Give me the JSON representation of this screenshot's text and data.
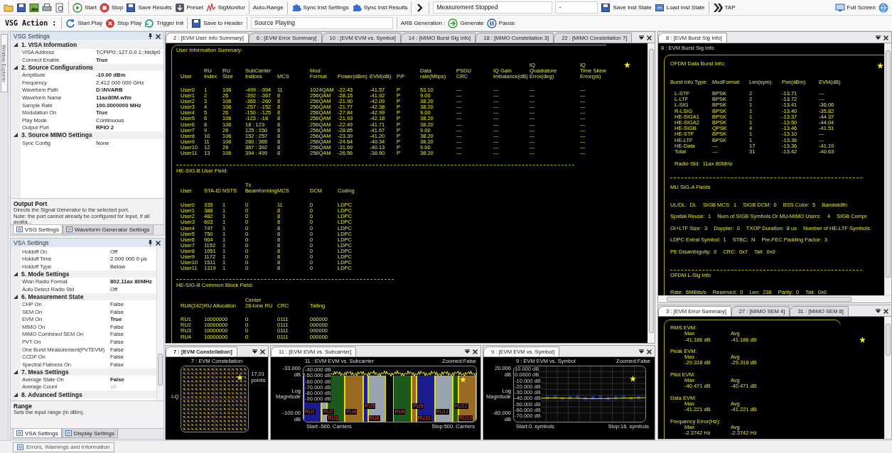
{
  "toolbar": {
    "row1": {
      "left": [
        {
          "kind": "icon"
        },
        {
          "kind": "icon"
        },
        {
          "kind": "icon"
        },
        {
          "kind": "icon"
        },
        {
          "kind": "icon"
        },
        {
          "kind": "sep"
        },
        {
          "kind": "button",
          "label": "Start"
        },
        {
          "kind": "button",
          "label": "Stop"
        },
        {
          "kind": "button",
          "label": "Save Results"
        },
        {
          "kind": "button",
          "label": "Preset"
        },
        {
          "kind": "button",
          "label": "SigMonitor"
        },
        {
          "kind": "sep"
        },
        {
          "kind": "text",
          "label": "Auto-Range"
        },
        {
          "kind": "sep"
        },
        {
          "kind": "button",
          "label": "Sync Inst Settings"
        },
        {
          "kind": "button",
          "label": "Sync Inst Results"
        },
        {
          "kind": "sep"
        },
        {
          "kind": "icon"
        },
        {
          "kind": "sep"
        },
        {
          "kind": "status",
          "label": "Measurement Stopped"
        },
        {
          "kind": "status",
          "label": "-"
        },
        {
          "kind": "button",
          "label": "Save Inst State"
        },
        {
          "kind": "button",
          "label": "Load Inst State"
        },
        {
          "kind": "sep"
        },
        {
          "kind": "button",
          "label": "TAP"
        }
      ],
      "right": [
        {
          "kind": "button",
          "label": "Full Screen"
        },
        {
          "kind": "icon"
        }
      ]
    },
    "row2": [
      {
        "kind": "title",
        "label": "VSG Action :"
      },
      {
        "kind": "sep"
      },
      {
        "kind": "button",
        "label": "Start Play"
      },
      {
        "kind": "button",
        "label": "Stop Play"
      },
      {
        "kind": "button",
        "label": "Trigger Init"
      },
      {
        "kind": "sep"
      },
      {
        "kind": "button",
        "label": "Save to Header"
      },
      {
        "kind": "sep"
      },
      {
        "kind": "status",
        "label": "Source Playing"
      },
      {
        "kind": "sep"
      },
      {
        "kind": "text",
        "label": "ARB Generation :"
      },
      {
        "kind": "button",
        "label": "Generate"
      },
      {
        "kind": "button",
        "label": "Pause"
      }
    ]
  },
  "side_tab": "Window Explorer",
  "vsg_panel": {
    "title": "VSG Settings",
    "grid": [
      {
        "kind": "category",
        "name": "1. VISA Information",
        "expanded": true
      },
      {
        "kind": "property",
        "name": "VISA Address",
        "value": "TCPIP0::127.0.0.1::hislip0",
        "bold": false
      },
      {
        "kind": "property",
        "name": "Connect Enable",
        "value": "True",
        "bold": true
      },
      {
        "kind": "category",
        "name": "2. Source Configurations",
        "expanded": true
      },
      {
        "kind": "property",
        "name": "Amplitude",
        "value": "-10.00 dBm",
        "bold": true
      },
      {
        "kind": "property",
        "name": "Frequency",
        "value": "2.412 000 000 GHz",
        "bold": false
      },
      {
        "kind": "property",
        "name": "Waveform Path",
        "value": "D:\\NVARB",
        "bold": true
      },
      {
        "kind": "property",
        "name": "Waveform Name",
        "value": "11ax80M.wfm",
        "bold": true
      },
      {
        "kind": "property",
        "name": "Sample Rate",
        "value": "100.0000000 MHz",
        "bold": true
      },
      {
        "kind": "property",
        "name": "Modulation On",
        "value": "True",
        "bold": true
      },
      {
        "kind": "property",
        "name": "Play Mode",
        "value": "Continuous",
        "bold": false
      },
      {
        "kind": "property",
        "name": "Output Port",
        "value": "RFIO 2",
        "bold": true
      },
      {
        "kind": "category",
        "name": "3. Source MIMO Settings",
        "expanded": true
      },
      {
        "kind": "property",
        "name": "Sync Config",
        "value": "None",
        "bold": false
      }
    ],
    "description": {
      "title": "Output Port",
      "lines": [
        "Directs the Signal Generator to the selected port.",
        "Note: the port cannot already be configured for Input, if all availa..."
      ]
    },
    "tabs": [
      {
        "label": "VSG Settings",
        "selected": true
      },
      {
        "label": "Waveform Generator Settings",
        "selected": false
      }
    ]
  },
  "vsa_panel": {
    "title": "VSA Settings",
    "grid": [
      {
        "kind": "property",
        "name": "Holdoff On",
        "value": "Off",
        "bold": false,
        "disabled": false
      },
      {
        "kind": "property",
        "name": "Holdoff Time",
        "value": "2.000 000 0 µs",
        "bold": false,
        "disabled": false
      },
      {
        "kind": "property",
        "name": "Holdoff Type",
        "value": "Below",
        "bold": false,
        "disabled": false
      },
      {
        "kind": "category",
        "name": "5. Mode Settings",
        "expanded": true
      },
      {
        "kind": "property",
        "name": "Wlan Radio Format",
        "value": "802.11ax 80MHz",
        "bold": true,
        "disabled": false
      },
      {
        "kind": "property",
        "name": "Auto Detect Radio Std",
        "value": "Off",
        "bold": false,
        "disabled": false
      },
      {
        "kind": "category",
        "name": "6. Measurement State",
        "expanded": true
      },
      {
        "kind": "property",
        "name": "CHP On",
        "value": "False",
        "bold": false,
        "disabled": false
      },
      {
        "kind": "property",
        "name": "SEM On",
        "value": "False",
        "bold": false,
        "disabled": false
      },
      {
        "kind": "property",
        "name": "EVM On",
        "value": "True",
        "bold": true,
        "disabled": false
      },
      {
        "kind": "property",
        "name": "MIMO On",
        "value": "False",
        "bold": false,
        "disabled": false
      },
      {
        "kind": "property",
        "name": "MIMO Combined SEM On",
        "value": "False",
        "bold": false,
        "disabled": false
      },
      {
        "kind": "property",
        "name": "PVT On",
        "value": "False",
        "bold": false,
        "disabled": false
      },
      {
        "kind": "property",
        "name": "One Burst Measurement(PVTEVM)",
        "value": "False",
        "bold": false,
        "disabled": false
      },
      {
        "kind": "property",
        "name": "CCDF On",
        "value": "False",
        "bold": false,
        "disabled": false
      },
      {
        "kind": "property",
        "name": "Spectral Flatness On",
        "value": "False",
        "bold": false,
        "disabled": false
      },
      {
        "kind": "category",
        "name": "7. Meas Settings",
        "expanded": true
      },
      {
        "kind": "property",
        "name": "Average State On",
        "value": "False",
        "bold": true,
        "disabled": false
      },
      {
        "kind": "property",
        "name": "Average Count",
        "value": "10",
        "bold": false,
        "disabled": true
      },
      {
        "kind": "category",
        "name": "8. Advanced Settings",
        "expanded": true
      }
    ],
    "description": {
      "title": "Range",
      "lines": [
        "Sets the input range (in dBm)."
      ]
    },
    "tabs": [
      {
        "label": "VSA Settings",
        "selected": true
      },
      {
        "label": "Display Settings",
        "selected": false
      }
    ]
  },
  "status_tab": "Errors, Warnings and Information",
  "user_info": {
    "tabs": [
      {
        "label": "2 : [EVM User Info Summary]",
        "selected": true
      },
      {
        "label": "6 : [EVM Error Summary]",
        "selected": false
      },
      {
        "label": "10 : [EVM EVM vs. Symbol]",
        "selected": false
      },
      {
        "label": "14 : [MIMO Burst Sig Info]",
        "selected": false
      },
      {
        "label": "18 : [MIMO Constellation 3]",
        "selected": false
      },
      {
        "label": "22 : [MIMO Constellation 7]",
        "selected": false
      }
    ],
    "summary_title": "User Information Summary:",
    "summary_columns": [
      "User",
      "RU\nIndex",
      "RU\nSize",
      "SubCarrier\nIndices",
      "MCS",
      "Mod\nFormat",
      "Power(dBm)",
      "EVM(dB)",
      "P/F",
      "Data\nrate(Mbps)",
      "PSDU\nCRC",
      "IQ Gain\nImbalance(dB)",
      "IQ\nQuadrature\nError(deg)",
      "IQ\nTime Skew\nError(ps)"
    ],
    "summary_rows": [
      [
        "User0",
        "1",
        "106",
        "-499 : -394",
        "11",
        "1024QAM",
        "-22.43",
        "-41.57",
        "P",
        "53.10",
        "---",
        "---",
        "---",
        "---"
      ],
      [
        "User1",
        "2",
        "26",
        "-392 : -367",
        "8",
        "256QAM",
        "-28.15",
        "-41.92",
        "P",
        "9.00",
        "---",
        "---",
        "---",
        "---"
      ],
      [
        "User2",
        "3",
        "106",
        "-365 : -260",
        "8",
        "256QAM",
        "-21.90",
        "-42.09",
        "P",
        "38.20",
        "---",
        "---",
        "---",
        "---"
      ],
      [
        "User3",
        "4",
        "106",
        "-257 : -152",
        "8",
        "256QAM",
        "-21.77",
        "-42.38",
        "P",
        "38.20",
        "---",
        "---",
        "---",
        "---"
      ],
      [
        "User4",
        "5",
        "26",
        "-150 : -125",
        "8",
        "256QAM",
        "-27.84",
        "-42.99",
        "P",
        "9.00",
        "---",
        "---",
        "---",
        "---"
      ],
      [
        "User5",
        "6",
        "106",
        "-123 : -18",
        "8",
        "256QAM",
        "-21.93",
        "-42.18",
        "P",
        "38.20",
        "---",
        "---",
        "---",
        "---"
      ],
      [
        "User6",
        "8",
        "106",
        "18 : 123",
        "8",
        "256QAM",
        "-22.49",
        "-41.71",
        "P",
        "38.20",
        "---",
        "---",
        "---",
        "---"
      ],
      [
        "User7",
        "9",
        "26",
        "125 : 150",
        "8",
        "256QAM",
        "-28.85",
        "-41.67",
        "P",
        "9.00",
        "---",
        "---",
        "---",
        "---"
      ],
      [
        "User8",
        "10",
        "106",
        "152 : 257",
        "8",
        "256QAM",
        "-23.39",
        "-41.20",
        "P",
        "38.20",
        "---",
        "---",
        "---",
        "---"
      ],
      [
        "User9",
        "11",
        "106",
        "260 : 365",
        "8",
        "256QAM",
        "-24.64",
        "-40.34",
        "P",
        "38.20",
        "---",
        "---",
        "---",
        "---"
      ],
      [
        "User10",
        "12",
        "26",
        "367 : 392",
        "8",
        "256QAM",
        "-31.69",
        "-40.13",
        "P",
        "9.00",
        "---",
        "---",
        "---",
        "---"
      ],
      [
        "User11",
        "13",
        "106",
        "394 : 499",
        "8",
        "256QAM",
        "-26.56",
        "-38.90",
        "P",
        "38.20",
        "---",
        "---",
        "---",
        "---"
      ]
    ],
    "user_field_title": "HE-SIG-B User Field:",
    "user_field_columns": [
      "User",
      "STA-ID",
      "NSTS",
      "Tx\nBeamforming",
      "MCS",
      "DCM",
      "Coding"
    ],
    "user_field_rows": [
      [
        "User0",
        "335",
        "1",
        "0",
        "11",
        "0",
        "LDPC"
      ],
      [
        "User1",
        "388",
        "1",
        "0",
        "8",
        "0",
        "LDPC"
      ],
      [
        "User2",
        "482",
        "1",
        "0",
        "8",
        "0",
        "LDPC"
      ],
      [
        "User3",
        "603",
        "1",
        "0",
        "8",
        "0",
        "LDPC"
      ],
      [
        "User4",
        "747",
        "1",
        "0",
        "8",
        "0",
        "LDPC"
      ],
      [
        "User5",
        "750",
        "1",
        "0",
        "8",
        "0",
        "LDPC"
      ],
      [
        "User6",
        "904",
        "1",
        "0",
        "8",
        "0",
        "LDPC"
      ],
      [
        "User7",
        "1152",
        "1",
        "0",
        "8",
        "0",
        "LDPC"
      ],
      [
        "User8",
        "1051",
        "1",
        "0",
        "8",
        "0",
        "LDPC"
      ],
      [
        "User9",
        "1172",
        "1",
        "0",
        "8",
        "0",
        "LDPC"
      ],
      [
        "User10",
        "1511",
        "1",
        "0",
        "8",
        "0",
        "LDPC"
      ],
      [
        "User11",
        "1319",
        "1",
        "0",
        "8",
        "0",
        "LDPC"
      ]
    ],
    "common_title": "HE-SIG-B Common Block Field:",
    "common_columns": [
      "RU#(242)",
      "RU Allocation",
      "Center\n26-tone RU",
      "CRC",
      "Tailing"
    ],
    "common_rows": [
      [
        "RU1",
        "10000000",
        "0",
        "0111",
        "000000"
      ],
      [
        "RU2",
        "10000000",
        "0",
        "0111",
        "000000"
      ],
      [
        "RU3",
        "10000000",
        "0",
        "0111",
        "000000"
      ],
      [
        "RU4",
        "10000000",
        "0",
        "0111",
        "000000"
      ]
    ]
  },
  "burst_panel": {
    "tabs": [
      {
        "label": "8 : [EVM Burst Sig Info]",
        "selected": true
      }
    ],
    "title": "8 : EVM Burst Sig Info",
    "data_title": "OFDM Data Burst Info:",
    "columns": [
      "Burst Info Type:",
      "ModFormat",
      "Len(sym)",
      "Pwr(dBm)",
      "EVM(dB)"
    ],
    "rows": [
      [
        "L-STF",
        "BPSK",
        "2",
        "-13.71",
        "---"
      ],
      [
        "L-LTF",
        "BPSK",
        "2",
        "-13.72",
        "---"
      ],
      [
        "L-SIG",
        "BPSK",
        "1",
        "-13.41",
        "-36.06"
      ],
      [
        "R-LSIG",
        "BPSK",
        "1",
        "-13.40",
        "-35.82"
      ],
      [
        "HE-SIGA1",
        "BPSK",
        "1",
        "-13.37",
        "-44.37"
      ],
      [
        "HE-SIGA2",
        "BPSK",
        "1",
        "-13.50",
        "-44.04"
      ],
      [
        "HE-SIGB",
        "QPSK",
        "4",
        "-13.46",
        "-41.51"
      ],
      [
        "HE-STF",
        "BPSK",
        "1",
        "-13.10",
        "---"
      ],
      [
        "HE-LTF",
        "BPSK",
        "1",
        "-13.36",
        "---"
      ],
      [
        "HE-Data",
        "---",
        "17",
        "-13.36",
        "-41.19"
      ],
      [
        "Total",
        "---",
        "31",
        "-13.42",
        "-40.63"
      ]
    ],
    "radio_std": "Radio Std:  11ax 80MHz",
    "sig_a_title": "MU SIG-A Fields",
    "sig_a_rows": [
      [
        "UL/DL:  DL",
        "SIGB MCS:  1",
        "SIGB DCM:  0",
        "BSS Color:  5",
        "Bandwidth:"
      ],
      [
        "Spatial Reuse:  1",
        "Num of SIGB Symbols Or MU-MIMO Users:",
        "4",
        "SIGB Compr"
      ],
      [
        "GI+LTF Size:  3",
        "Doppler:  0",
        "TXOP Duration:  8 us",
        "Number of HE-LTF Symbols:"
      ],
      [
        "LDPC Extral Symbol:  1",
        "STBC:  N",
        "Pre-FEC Padding Factor:  3"
      ],
      [
        "PE Disambiguity:  0",
        "CRC:  0x7",
        "Tail:  0x0"
      ]
    ],
    "lsig_title": "OFDM L-Sig Info",
    "lsig_items": [
      "Rate:  6MBits/s",
      "Reserved:  0",
      "Len:  236",
      "Parity:  0",
      "Tail:  0x0"
    ]
  },
  "error_panel": {
    "tabs": [
      {
        "label": "3 : [EVM Error Summary]",
        "selected": true
      },
      {
        "label": "27 : [MIMO SEM 4]",
        "selected": false
      },
      {
        "label": "31 : [MIMO SEM 8]",
        "selected": false
      }
    ],
    "sections": [
      {
        "title": "RMS EVM:",
        "max_label": "Max",
        "avg_label": "Avg",
        "max": "-41.186 dB",
        "avg": "-41.186 dB"
      },
      {
        "title": "Peak EVM:",
        "max_label": "Max",
        "avg_label": "Avg",
        "max": "-29.318 dB",
        "avg": "-29.318 dB"
      },
      {
        "title": "Pilot EVM:",
        "max_label": "Max",
        "avg_label": "Avg",
        "max": "-40.471 dB",
        "avg": "-40.471 dB"
      },
      {
        "title": "Data EVM:",
        "max_label": "Max",
        "avg_label": "Avg",
        "max": "-41.221 dB",
        "avg": "-41.221 dB"
      },
      {
        "title": "Frequency Error(Hz):",
        "max_label": "Max",
        "avg_label": "Avg",
        "max": "-2.3742 Hz",
        "avg": "-2.3742 Hz"
      }
    ]
  },
  "constellation": {
    "tab": {
      "label": "7 : [EVM Constellation]",
      "selected": true
    },
    "focused": true,
    "title": "7 : EVM Constellation",
    "y_label": "I-Q",
    "points_count": "17,01",
    "points_unit": "points"
  },
  "subcarrier": {
    "tab": {
      "label": "11 : [EVM EVM vs. Subcarrier]",
      "selected": true
    },
    "focused": false,
    "title": "11 : EVM EVM vs. Subcarrier",
    "zoom": "Zoomed:False",
    "y_top": "-33.000\ndB",
    "y_label": "Log\nMagnitude",
    "y_bottom": "-100.00\ndB",
    "grid_labels": [
      "-40.000 dB",
      "-50.000 dB",
      "-60.000 dB",
      "-70.000 dB",
      "-80.000 dB",
      "-90.000 dB"
    ],
    "segments": [
      {
        "label": "RU1",
        "color": "#1c1c8e"
      },
      {
        "label": "RU2",
        "color": "#9aa4b0"
      },
      {
        "label": "RU3",
        "color": "#1e5a1e"
      },
      {
        "label": "RU4",
        "color": "#9a6a22"
      },
      {
        "label": "RU5",
        "color": "#1c1c8e"
      },
      {
        "label": "RU6",
        "color": "#9aa4b0"
      },
      {
        "label": "RU8",
        "color": "#1e5a1e"
      },
      {
        "label": "RU9",
        "color": "#9a6a22"
      },
      {
        "label": "RU10",
        "color": "#1c1c8e"
      },
      {
        "label": "RU11",
        "color": "#9aa4b0"
      },
      {
        "label": "RU12",
        "color": "#1e5a1e"
      },
      {
        "label": "RU13",
        "color": "#9a6a22"
      }
    ],
    "start": "Start:-500. Carriers",
    "stop": "Stop:500. Carriers"
  },
  "symbol": {
    "tab": {
      "label": "9 : [EVM EVM vs. Symbol]",
      "selected": true
    },
    "focused": false,
    "title": "9 : EVM EVM vs. Symbol",
    "zoom": "Zoomed:False",
    "y_top": "20.000\ndB",
    "y_label": "Log\nMagnitude",
    "y_bottom": "-80.000\ndB",
    "grid_labels": [
      "10.000 dB",
      "0.0000 dB",
      "-10.000 dB",
      "-20.000 dB",
      "-30.000 dB",
      "-40.000 dB",
      "-50.000 dB",
      "-60.000 dB",
      "-70.000 dB"
    ],
    "start": "Start:0. symbols",
    "stop": "Stop:16. symbols"
  }
}
